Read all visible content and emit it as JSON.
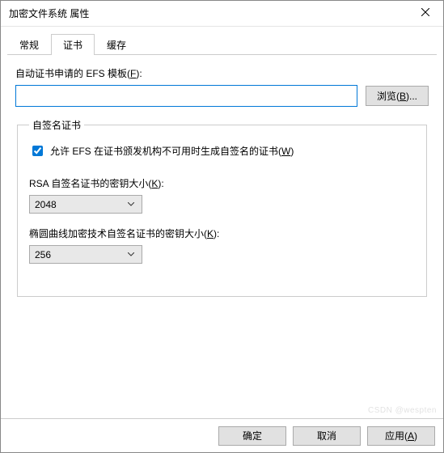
{
  "window": {
    "title": "加密文件系统 属性",
    "close": "×"
  },
  "tabs": {
    "general": "常规",
    "certs": "证书",
    "cache": "缓存"
  },
  "template": {
    "label_pre": "自动证书申请的 EFS 模板(",
    "label_key": "F",
    "label_post": "):",
    "value": "",
    "browse_pre": "浏览(",
    "browse_key": "B",
    "browse_post": ")..."
  },
  "fieldset": {
    "legend": "自签名证书",
    "checkbox_pre": "允许 EFS 在证书颁发机构不可用时生成自签名的证书(",
    "checkbox_key": "W",
    "checkbox_post": ")",
    "checked": true,
    "rsa_label_pre": "RSA 自签名证书的密钥大小(",
    "rsa_label_key": "K",
    "rsa_label_post": "):",
    "rsa_value": "2048",
    "ecc_label_pre": "椭圆曲线加密技术自签名证书的密钥大小(",
    "ecc_label_key": "K",
    "ecc_label_post": "):",
    "ecc_value": "256"
  },
  "footer": {
    "ok": "确定",
    "cancel": "取消",
    "apply_pre": "应用(",
    "apply_key": "A",
    "apply_post": ")"
  },
  "watermark": "CSDN @wespten"
}
